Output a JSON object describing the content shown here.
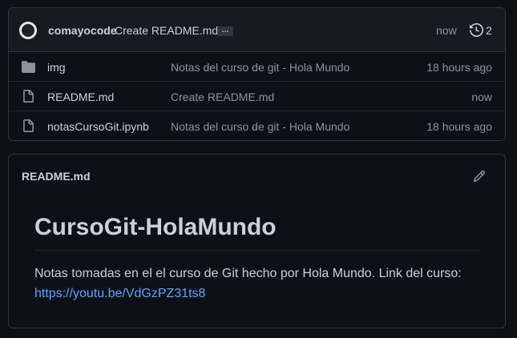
{
  "commit": {
    "author": "comayocode",
    "message": "Create README.md",
    "ellipsis": "…",
    "time": "now",
    "history_count": "2"
  },
  "files": [
    {
      "icon": "folder-icon",
      "name": "img",
      "commit": "Notas del curso de git - Hola Mundo",
      "time": "18 hours ago"
    },
    {
      "icon": "file-icon",
      "name": "README.md",
      "commit": "Create README.md",
      "time": "now"
    },
    {
      "icon": "file-icon",
      "name": "notasCursoGit.ipynb",
      "commit": "Notas del curso de git - Hola Mundo",
      "time": "18 hours ago"
    }
  ],
  "readme": {
    "header": "README.md",
    "title": "CursoGit-HolaMundo",
    "text": "Notas tomadas en el el curso de Git hecho por Hola Mundo. Link del curso:",
    "link": "https://youtu.be/VdGzPZ31ts8"
  },
  "colors": {
    "background": "#0d1117",
    "header_background": "#161b22",
    "border": "#30363d",
    "text": "#c9d1d9",
    "muted": "#8b949e",
    "link": "#58a6ff"
  }
}
